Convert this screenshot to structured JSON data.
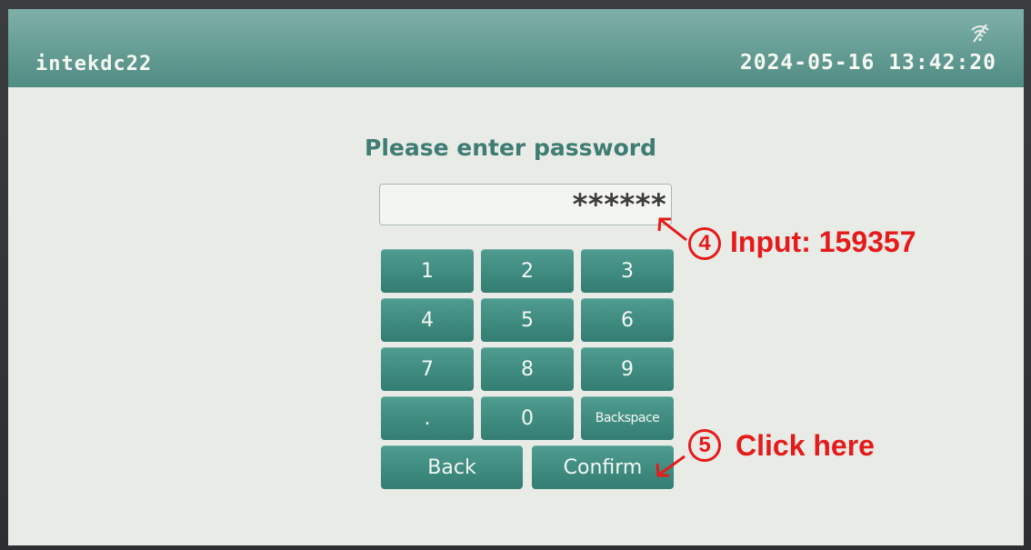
{
  "titlebar": {
    "device_name": "intekdc22",
    "clock": "2024-05-16 13:42:20",
    "wifi_icon": "wifi-off-icon"
  },
  "login": {
    "prompt": "Please enter password",
    "password_masked": "******"
  },
  "keypad": {
    "keys": [
      "1",
      "2",
      "3",
      "4",
      "5",
      "6",
      "7",
      "8",
      "9",
      ".",
      "0",
      "Backspace"
    ],
    "back_label": "Back",
    "confirm_label": "Confirm"
  },
  "annotations": {
    "step4_number": "4",
    "step4_text": "Input: 159357",
    "step5_number": "5",
    "step5_text": "Click here",
    "color": "#e51b1b"
  },
  "colors": {
    "accent": "#3f8a80",
    "titlebar": "#5f9a91",
    "screen_bg": "#e9ebe6"
  }
}
